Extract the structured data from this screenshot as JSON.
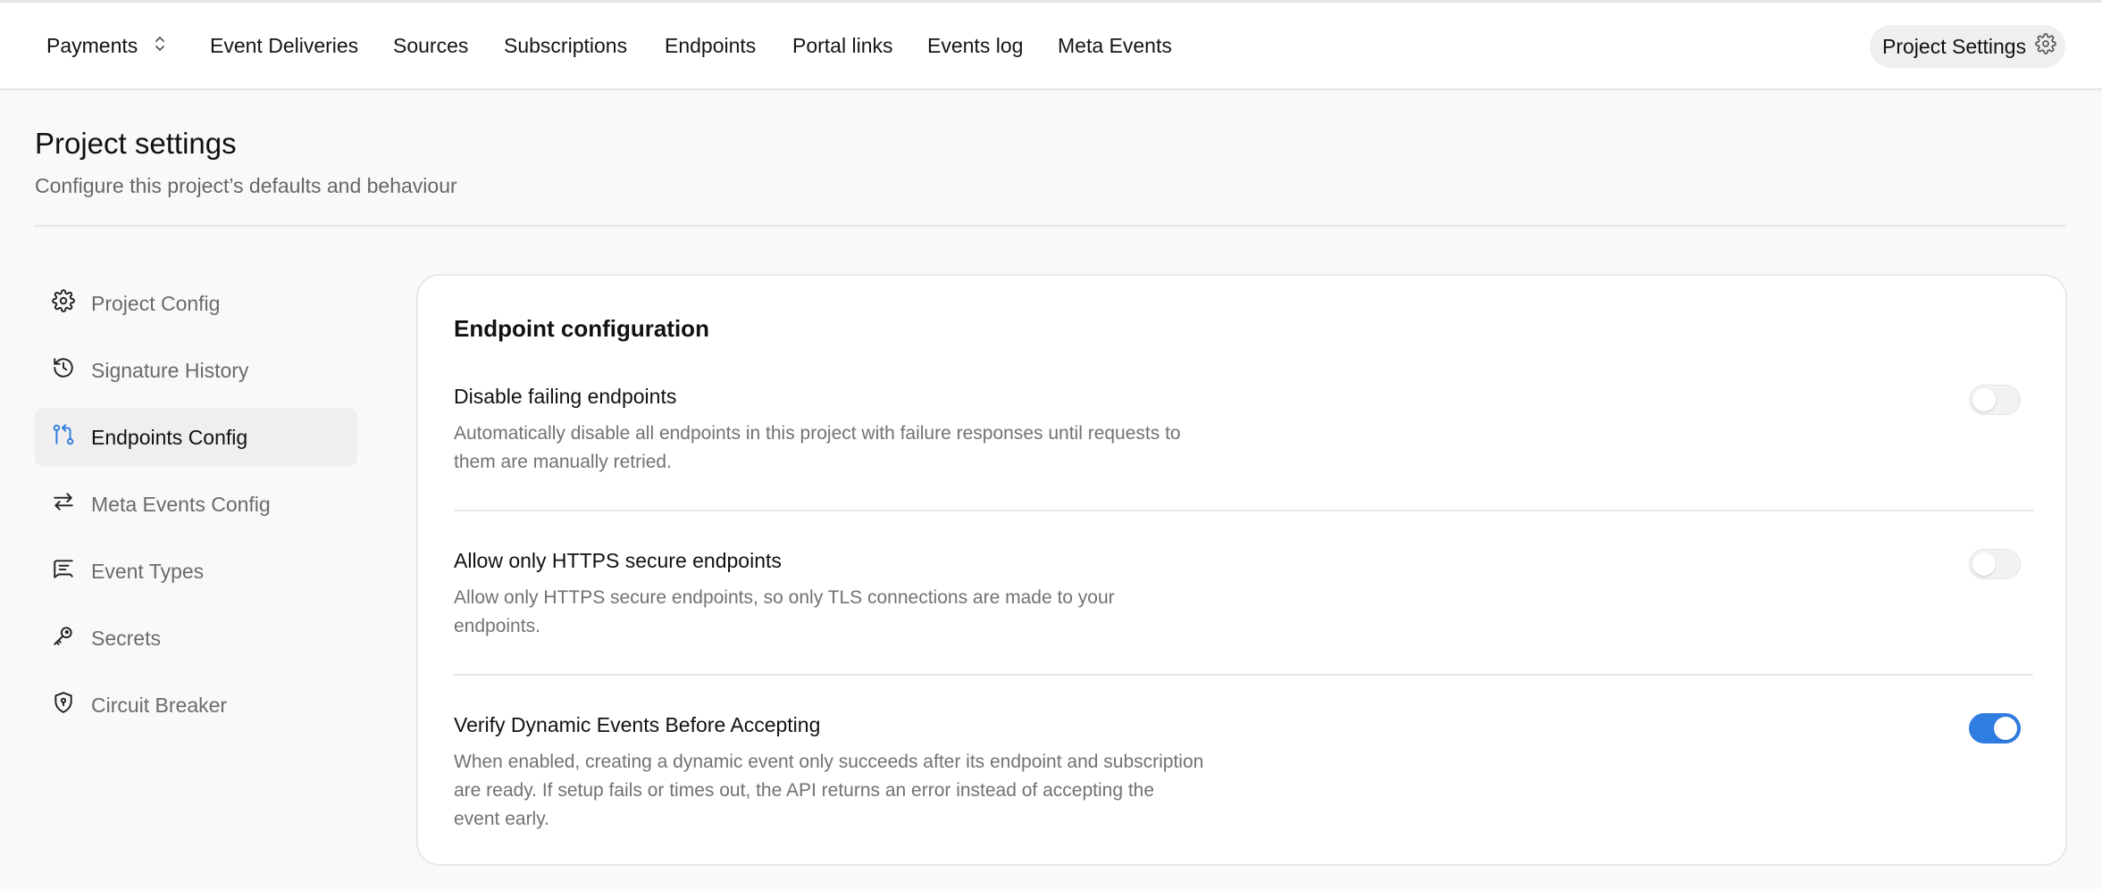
{
  "topbar": {
    "project_name": "Payments",
    "nav": [
      "Event Deliveries",
      "Sources",
      "Subscriptions",
      "Endpoints",
      "Portal links",
      "Events log",
      "Meta Events"
    ],
    "settings_label": "Project Settings"
  },
  "page": {
    "title": "Project settings",
    "subtitle": "Configure this project’s defaults and behaviour"
  },
  "sidebar": {
    "items": [
      {
        "label": "Project Config",
        "icon": "gear-icon",
        "active": false
      },
      {
        "label": "Signature History",
        "icon": "history-icon",
        "active": false
      },
      {
        "label": "Endpoints Config",
        "icon": "git-compare-icon",
        "active": true
      },
      {
        "label": "Meta Events Config",
        "icon": "arrows-swap-icon",
        "active": false
      },
      {
        "label": "Event Types",
        "icon": "message-list-icon",
        "active": false
      },
      {
        "label": "Secrets",
        "icon": "key-icon",
        "active": false
      },
      {
        "label": "Circuit Breaker",
        "icon": "shield-icon",
        "active": false
      }
    ]
  },
  "card": {
    "title": "Endpoint configuration",
    "settings": [
      {
        "title": "Disable failing endpoints",
        "description": "Automatically disable all endpoints in this project with failure responses until requests to them are manually retried.",
        "enabled": false
      },
      {
        "title": "Allow only HTTPS secure endpoints",
        "description": "Allow only HTTPS secure endpoints, so only TLS connections are made to your endpoints.",
        "enabled": false
      },
      {
        "title": "Verify Dynamic Events Before Accepting",
        "description": "When enabled, creating a dynamic event only succeeds after its endpoint and subscription are ready. If setup fails or times out, the API returns an error instead of accepting the event early.",
        "enabled": true
      }
    ]
  },
  "colors": {
    "accent": "#2f7de1",
    "background": "#faf9f7",
    "active_item": "#efefef"
  }
}
